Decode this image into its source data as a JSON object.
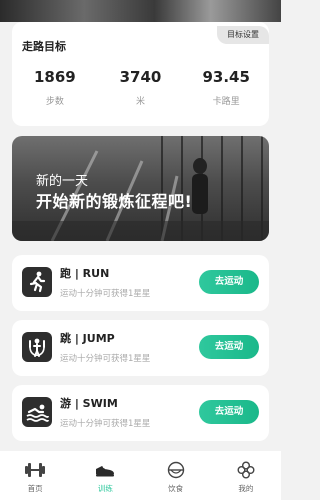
{
  "goal": {
    "title": "走路目标",
    "setting_label": "目标设置",
    "stats": [
      {
        "value": "1869",
        "label": "步数"
      },
      {
        "value": "3740",
        "label": "米"
      },
      {
        "value": "93.45",
        "label": "卡路里"
      }
    ]
  },
  "banner": {
    "line1": "新的一天",
    "line2": "开始新的锻炼征程吧!"
  },
  "sports": [
    {
      "title": "跑 | RUN",
      "subtitle": "运动十分钟可获得1星星",
      "button": "去运动",
      "icon": "running-icon"
    },
    {
      "title": "跳 | JUMP",
      "subtitle": "运动十分钟可获得1星星",
      "button": "去运动",
      "icon": "jump-rope-icon"
    },
    {
      "title": "游 | SWIM",
      "subtitle": "运动十分钟可获得1星星",
      "button": "去运动",
      "icon": "swimming-icon"
    }
  ],
  "tabs": [
    {
      "label": "首页",
      "icon": "dumbbell-icon"
    },
    {
      "label": "训练",
      "icon": "sneaker-icon",
      "active": true
    },
    {
      "label": "饮食",
      "icon": "bowl-icon"
    },
    {
      "label": "我的",
      "icon": "profile-icon"
    }
  ],
  "colors": {
    "accent": "#2fc89d",
    "icon_bg": "#2e2e2e"
  }
}
